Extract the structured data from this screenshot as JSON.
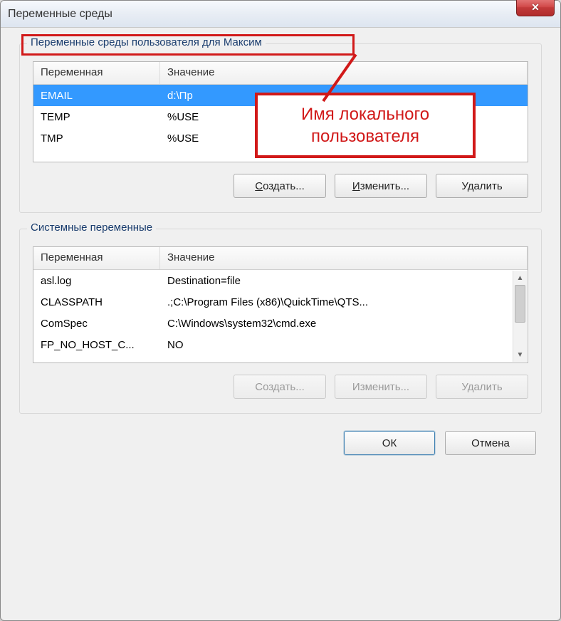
{
  "title": "Переменные среды",
  "annotation": {
    "callout": "Имя локального пользователя"
  },
  "user_vars": {
    "group_title": "Переменные среды пользователя для Максим",
    "headers": {
      "name": "Переменная",
      "value": "Значение"
    },
    "rows": [
      {
        "name": "EMAIL",
        "value": "d:\\Пр",
        "selected": true
      },
      {
        "name": "TEMP",
        "value": "%USE"
      },
      {
        "name": "TMP",
        "value": "%USE"
      }
    ],
    "buttons": {
      "create": "Создать...",
      "edit": "Изменить...",
      "delete": "Удалить"
    }
  },
  "system_vars": {
    "group_title": "Системные переменные",
    "headers": {
      "name": "Переменная",
      "value": "Значение"
    },
    "rows": [
      {
        "name": "asl.log",
        "value": "Destination=file"
      },
      {
        "name": "CLASSPATH",
        "value": ".;C:\\Program Files (x86)\\QuickTime\\QTS..."
      },
      {
        "name": "ComSpec",
        "value": "C:\\Windows\\system32\\cmd.exe"
      },
      {
        "name": "FP_NO_HOST_C...",
        "value": "NO"
      }
    ],
    "buttons": {
      "create": "Создать...",
      "edit": "Изменить...",
      "delete": "Удалить"
    },
    "buttons_disabled": true
  },
  "dialog_buttons": {
    "ok": "ОК",
    "cancel": "Отмена"
  }
}
